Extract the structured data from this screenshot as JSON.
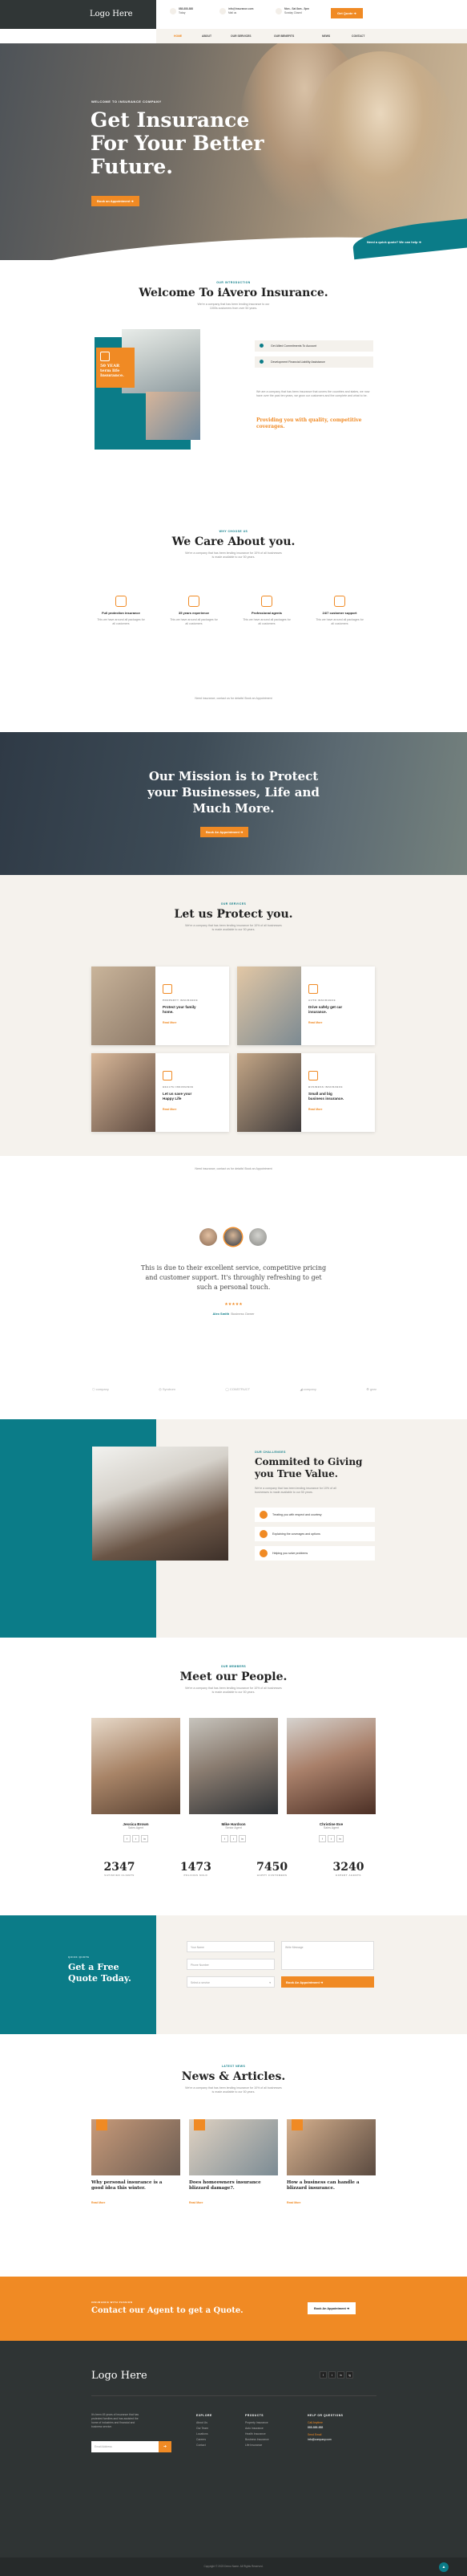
{
  "header": {
    "logo": "Logo Here",
    "phone_line1": "888-888-888",
    "phone_line2": "Today",
    "email_line1": "info@insurance.com",
    "email_line2": "Mail us",
    "hours_line1": "Mon - Sat 8am - 5pm",
    "hours_line2": "Sunday Closed",
    "cta": "Get Quote ➜",
    "nav": [
      "HOME",
      "ABOUT",
      "OUR SERVICES",
      "OUR BENEFITS",
      "NEWS",
      "CONTACT"
    ]
  },
  "hero": {
    "eyebrow": "WELCOME TO INSURANCE COMPANY",
    "title_line1": "Get Insurance",
    "title_line2": "For Your Better",
    "title_line3": "Future.",
    "cta": "Book an Appointment ➜",
    "quick_quote": "Need a quick quote? We can help ➜"
  },
  "welcome": {
    "eyebrow": "OUR INTRODUCTION",
    "title": "Welcome To iAvero Insurance.",
    "sub1": "We're a company that has been lending insurance to our",
    "sub2": "1000s customers from over 50 years.",
    "badge_line1": "50 YEAR",
    "badge_line2": "term life",
    "badge_line3": "Insurance.",
    "bullets": [
      "Get Allied Commitments To Account",
      "Development Financial Liability Assistance"
    ],
    "para": "We are a company that has been insurance that covers the countries and states, we now have over the past ten years, we grow our customers and the complete and what to be.",
    "highlight": "Providing you with quality, competitive coverages."
  },
  "care": {
    "eyebrow": "WHY CHOOSE US",
    "title": "We Care About you.",
    "sub1": "We're a company that has been lending insurance for 10% of all businesses",
    "sub2": "is made available to our 50 years.",
    "features": [
      {
        "title": "Full protection insurance",
        "text": "This we have around all packages for all customers"
      },
      {
        "title": "35 years experience",
        "text": "This we have around all packages for all customers"
      },
      {
        "title": "Professional agents",
        "text": "This we have around all packages for all customers"
      },
      {
        "title": "24/7 customer support",
        "text": "This we have around all packages for all customers"
      }
    ],
    "footnote": "Need insurance, contact us for details! Book an Appointment"
  },
  "mission": {
    "line1": "Our Mission is to Protect",
    "line2": "your Businesses, Life and",
    "line3": "Much More.",
    "cta": "Book An Appointment ➜"
  },
  "protect": {
    "eyebrow": "OUR SERVICES",
    "title": "Let us Protect you.",
    "sub1": "We're a company that has been lending insurance for 10% of all businesses",
    "sub2": "is made available to our 50 years.",
    "cards": [
      {
        "tag": "PROPERTY INSURANCE",
        "title1": "Protect your family",
        "title2": "home.",
        "link": "Read More"
      },
      {
        "tag": "AUTO INSURANCE",
        "title1": "Drive safely get car",
        "title2": "insurance.",
        "link": "Read More"
      },
      {
        "tag": "HEALTH INSURANCE",
        "title1": "Let us save your",
        "title2": "Happy Life",
        "link": "Read More"
      },
      {
        "tag": "BUSINESS INSURANCE",
        "title1": "Small and big",
        "title2": "business insurance.",
        "link": "Read More"
      }
    ],
    "footnote": "Need insurance, contact us for details! Book an Appointment"
  },
  "testimonial": {
    "quote1": "This is due to their excellent service, competitive pricing",
    "quote2": "and customer support. It's throughly refreshing to get",
    "quote3": "such a personal touch.",
    "stars": "★★★★★",
    "name": "Alex Smith",
    "role": "Business Owner"
  },
  "logos": [
    "company",
    "Syndrom",
    "CONSTRUCT",
    "company",
    "gear"
  ],
  "commit": {
    "eyebrow": "OUR CHALLENGES",
    "title1": "Commited to Giving",
    "title2": "you True Value.",
    "sub1": "We're a company that has been lending insurance for 10% of all",
    "sub2": "businesses is made available to our 50 years.",
    "items": [
      "Treating you with respect and courtesy",
      "Explaining the coverages and options",
      "Helping you solve problems"
    ]
  },
  "people": {
    "eyebrow": "OUR MEMBERS",
    "title": "Meet our People.",
    "sub1": "We're a company that has been lending insurance for 10% of all businesses",
    "sub2": "is made available to our 50 years.",
    "members": [
      {
        "name": "Jessica Brown",
        "role": "Sales Agent"
      },
      {
        "name": "Mike Hardson",
        "role": "Senior Agent"
      },
      {
        "name": "Christine Eve",
        "role": "Sales Agent"
      }
    ],
    "social": [
      "f",
      "t",
      "in"
    ]
  },
  "stats": [
    {
      "num": "2347",
      "label": "SATISFIED CLIENTS"
    },
    {
      "num": "1473",
      "label": "POLICIES SOLD"
    },
    {
      "num": "7450",
      "label": "HAPPY CUSTOMERS"
    },
    {
      "num": "3240",
      "label": "EXPERT AGENTS"
    }
  ],
  "quote": {
    "eyebrow": "QUICK QUOTE",
    "title1": "Get a Free",
    "title2": "Quote Today.",
    "name_ph": "Your Name",
    "phone_ph": "Phone Number",
    "select_ph": "Select a service",
    "msg_ph": "Write Message",
    "submit": "Book An Appointment ➜"
  },
  "news": {
    "eyebrow": "LATEST NEWS",
    "title": "News & Articles.",
    "sub1": "We're a company that has been lending insurance for 10% of all businesses",
    "sub2": "is made available to our 50 years.",
    "posts": [
      {
        "title1": "Why personal insurance is a",
        "title2": "good idea this winter.",
        "link": "Read More"
      },
      {
        "title1": "Does homeowners insurance",
        "title2": "blizzard damage?.",
        "link": "Read More"
      },
      {
        "title1": "How a business can handle a",
        "title2": "blizzard insurance.",
        "link": "Read More"
      }
    ]
  },
  "cta_band": {
    "eyebrow": "INSURANCE WITH PASSION",
    "title": "Contact our Agent to get a Quote.",
    "button": "Book An Appointment ➜"
  },
  "footer": {
    "logo": "Logo Here",
    "about1": "It's been 45 years of insurance that has",
    "about2": "protected families and has assisted the",
    "about3": "home of industries and financial and",
    "about4": "business service.",
    "email_ph": "Email Address",
    "col1_title": "EXPLORE",
    "col1": [
      "About Us",
      "Our Team",
      "Locations",
      "Careers",
      "Contact"
    ],
    "col2_title": "PRODUCTS",
    "col2": [
      "Property Insurance",
      "Auto Insurance",
      "Health Insurance",
      "Business Insurance",
      "Life Insurance"
    ],
    "col3_title": "HELP OR QUESTIONS",
    "call_label": "Call Anytime",
    "call": "888-888-888",
    "email_label": "Send Email",
    "email": "info@company.com",
    "social": [
      "f",
      "t",
      "in",
      "ig"
    ],
    "copyright": "Copyright © 2023 Demo Name. All Rights Reserved."
  }
}
